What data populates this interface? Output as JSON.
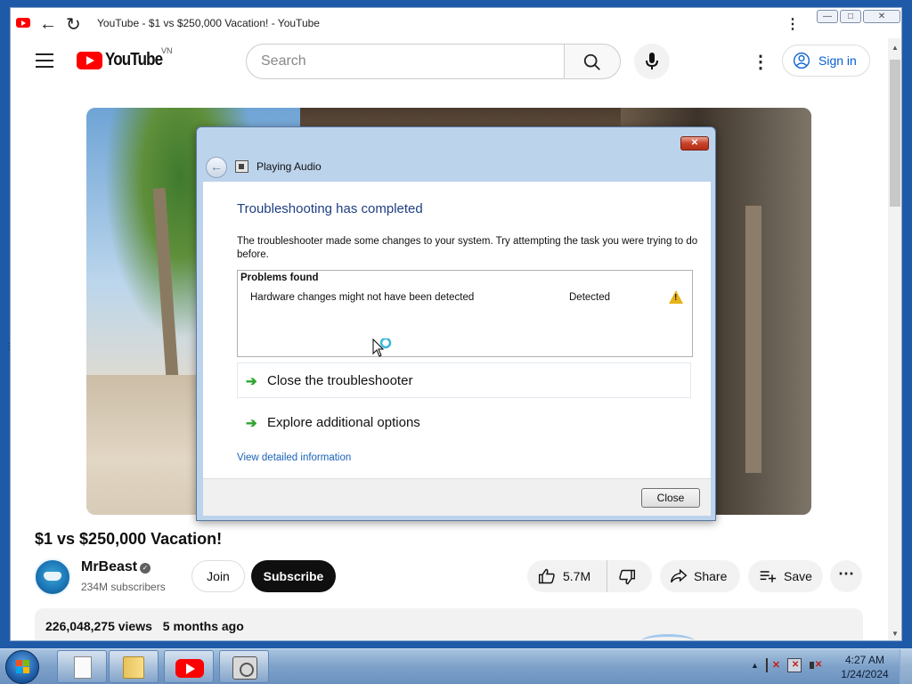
{
  "browser": {
    "page_title": "YouTube - $1 vs $250,000 Vacation! - YouTube"
  },
  "youtube": {
    "logo_text": "YouTube",
    "region": "VN",
    "search_placeholder": "Search",
    "sign_in": "Sign in"
  },
  "video": {
    "title": "$1 vs $250,000 Vacation!",
    "channel": "MrBeast",
    "subscribers": "234M subscribers",
    "join": "Join",
    "subscribe": "Subscribe",
    "likes": "5.7M",
    "share": "Share",
    "save": "Save",
    "views": "226,048,275 views",
    "age": "5 months ago"
  },
  "dialog": {
    "app_title": "Playing Audio",
    "close_x": "✕",
    "heading": "Troubleshooting has completed",
    "message": "The troubleshooter made some changes to your system. Try attempting the task you were trying to do before.",
    "problems_header": "Problems found",
    "problems": [
      {
        "name": "Hardware changes might not have been detected",
        "status": "Detected"
      }
    ],
    "options": [
      {
        "label": "Close the troubleshooter"
      },
      {
        "label": "Explore additional options"
      }
    ],
    "detail_link": "View detailed information",
    "close_button": "Close"
  },
  "taskbar": {
    "time": "4:27 AM",
    "date": "1/24/2024"
  },
  "colors": {
    "youtube_red": "#ff0000",
    "link_blue": "#065fd4",
    "dialog_heading": "#1e3f82",
    "taskbar": "#7da1c9"
  }
}
